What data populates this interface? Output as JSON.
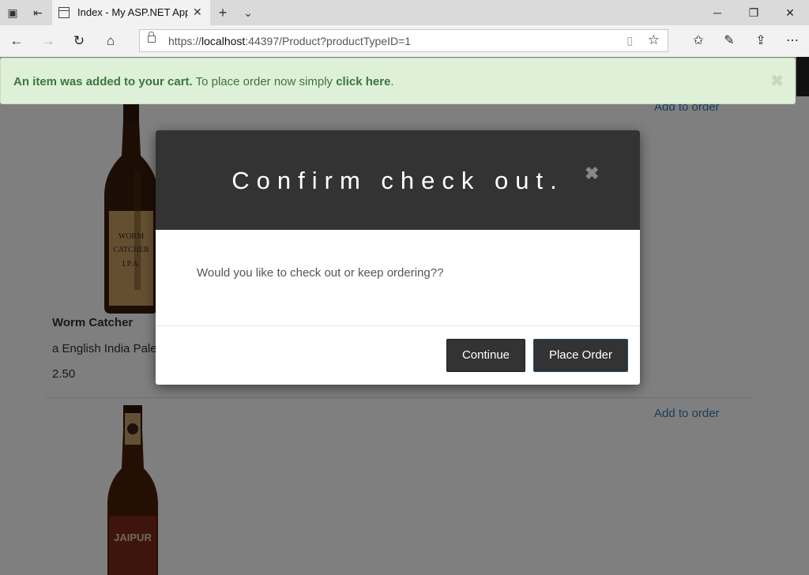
{
  "browser": {
    "tab_title": "Index - My ASP.NET App",
    "url_prefix": "https://",
    "url_host": "localhost",
    "url_rest": ":44397/Product?productTypeID=1"
  },
  "alert": {
    "bold_text": "An item was added to your cart.",
    "text": " To place order now simply ",
    "link_text": "click here",
    "suffix": ".",
    "close": "✖"
  },
  "modal": {
    "title": "Confirm check out.",
    "close": "✖",
    "body": "Would you like to check out or keep ordering??",
    "continue_label": "Continue",
    "place_order_label": "Place Order"
  },
  "products": [
    {
      "name": "Worm Catcher",
      "description": "a English India Pale Ale",
      "price": "2.50",
      "add_label": "Add to order",
      "label_text": "WORM CATCHER I.P.A."
    },
    {
      "name": "",
      "description": "",
      "price": "",
      "add_label": "Add to order",
      "label_text": "JAIPUR"
    }
  ]
}
